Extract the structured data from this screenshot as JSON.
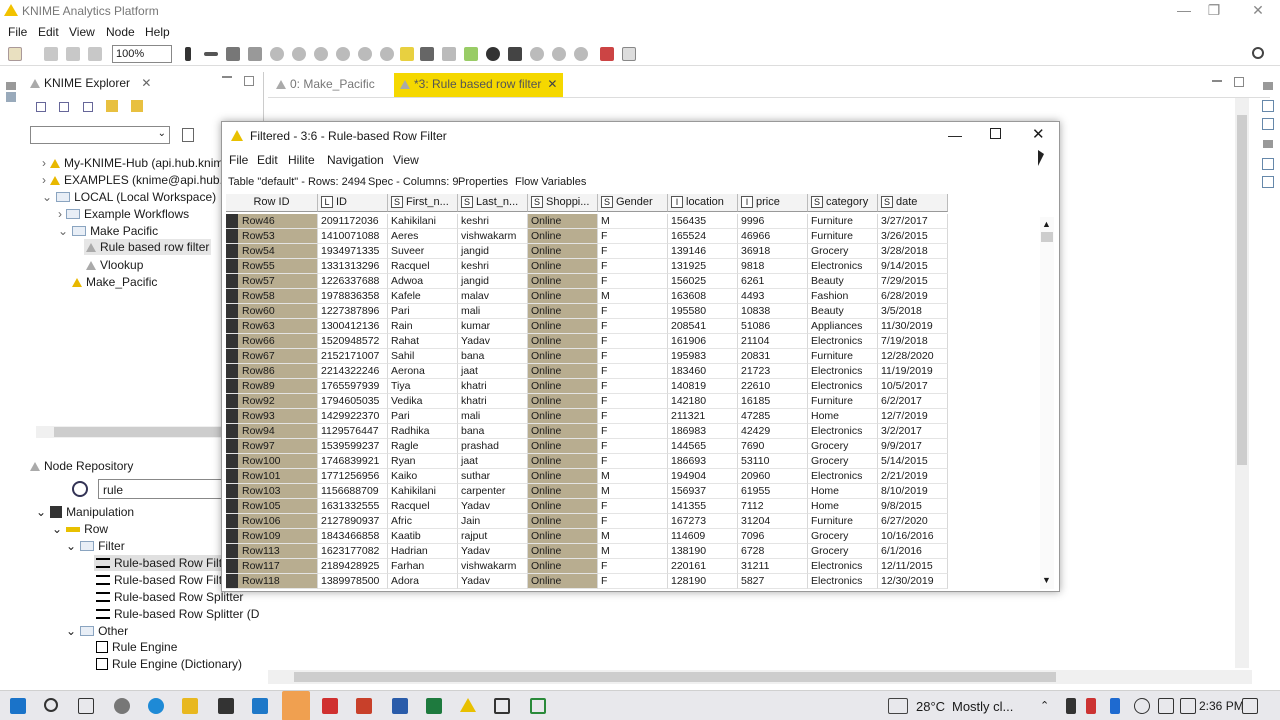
{
  "app": {
    "title": "KNIME Analytics Platform"
  },
  "menu": [
    "File",
    "Edit",
    "View",
    "Node",
    "Help"
  ],
  "toolbar": {
    "zoom": "100%"
  },
  "explorer": {
    "title": "KNIME Explorer",
    "items": [
      "My-KNIME-Hub (api.hub.knim",
      "EXAMPLES (knime@api.hub.k",
      "LOCAL (Local Workspace)",
      "Example Workflows",
      "Make Pacific",
      "Rule based row filter",
      "Vlookup",
      "Make_Pacific"
    ]
  },
  "repo": {
    "title": "Node Repository",
    "search": "rule",
    "items": [
      "Manipulation",
      "Row",
      "Filter",
      "Rule-based Row Filter",
      "Rule-based Row Filter",
      "Rule-based Row Splitter",
      "Rule-based Row Splitter (D",
      "Other",
      "Rule Engine",
      "Rule Engine (Dictionary)"
    ]
  },
  "editor": {
    "tabs": [
      "0: Make_Pacific",
      "*3: Rule based row filter"
    ]
  },
  "window": {
    "title": "Filtered - 3:6 - Rule-based Row Filter",
    "menu": [
      "File",
      "Edit",
      "Hilite",
      "Navigation",
      "View"
    ],
    "info": {
      "table": "Table \"default\" - Rows: 2494",
      "spec": "Spec - Columns: 9",
      "props": "Properties",
      "flow": "Flow Variables"
    },
    "columns": [
      {
        "type": "",
        "name": "Row ID"
      },
      {
        "type": "L",
        "name": "ID"
      },
      {
        "type": "S",
        "name": "First_n..."
      },
      {
        "type": "S",
        "name": "Last_n..."
      },
      {
        "type": "S",
        "name": "Shoppi..."
      },
      {
        "type": "S",
        "name": "Gender"
      },
      {
        "type": "I",
        "name": "location"
      },
      {
        "type": "I",
        "name": "price"
      },
      {
        "type": "S",
        "name": "category"
      },
      {
        "type": "S",
        "name": "date"
      }
    ],
    "rows": [
      [
        "Row46",
        "2091172036",
        "Kahikilani",
        "keshri",
        "Online",
        "M",
        "156435",
        "9996",
        "Furniture",
        "3/27/2017"
      ],
      [
        "Row53",
        "1410071088",
        "Aeres",
        "vishwakarm",
        "Online",
        "F",
        "165524",
        "46966",
        "Furniture",
        "3/26/2015"
      ],
      [
        "Row54",
        "1934971335",
        "Suveer",
        "jangid",
        "Online",
        "F",
        "139146",
        "36918",
        "Grocery",
        "3/28/2018"
      ],
      [
        "Row55",
        "1331313296",
        "Racquel",
        "keshri",
        "Online",
        "F",
        "131925",
        "9818",
        "Electronics",
        "9/14/2015"
      ],
      [
        "Row57",
        "1226337688",
        "Adwoa",
        "jangid",
        "Online",
        "F",
        "156025",
        "6261",
        "Beauty",
        "7/29/2015"
      ],
      [
        "Row58",
        "1978836358",
        "Kafele",
        "malav",
        "Online",
        "M",
        "163608",
        "4493",
        "Fashion",
        "6/28/2019"
      ],
      [
        "Row60",
        "1227387896",
        "Pari",
        "mali",
        "Online",
        "F",
        "195580",
        "10838",
        "Beauty",
        "3/5/2018"
      ],
      [
        "Row63",
        "1300412136",
        "Rain",
        "kumar",
        "Online",
        "F",
        "208541",
        "51086",
        "Appliances",
        "11/30/2019"
      ],
      [
        "Row66",
        "1520948572",
        "Rahat",
        "Yadav",
        "Online",
        "F",
        "161906",
        "21104",
        "Electronics",
        "7/19/2018"
      ],
      [
        "Row67",
        "2152171007",
        "Sahil",
        "bana",
        "Online",
        "F",
        "195983",
        "20831",
        "Furniture",
        "12/28/2020"
      ],
      [
        "Row86",
        "2214322246",
        "Aerona",
        "jaat",
        "Online",
        "F",
        "183460",
        "21723",
        "Electronics",
        "11/19/2019"
      ],
      [
        "Row89",
        "1765597939",
        "Tiya",
        "khatri",
        "Online",
        "F",
        "140819",
        "22610",
        "Electronics",
        "10/5/2017"
      ],
      [
        "Row92",
        "1794605035",
        "Vedika",
        "khatri",
        "Online",
        "F",
        "142180",
        "16185",
        "Furniture",
        "6/2/2017"
      ],
      [
        "Row93",
        "1429922370",
        "Pari",
        "mali",
        "Online",
        "F",
        "211321",
        "47285",
        "Home",
        "12/7/2019"
      ],
      [
        "Row94",
        "1129576447",
        "Radhika",
        "bana",
        "Online",
        "F",
        "186983",
        "42429",
        "Electronics",
        "3/2/2017"
      ],
      [
        "Row97",
        "1539599237",
        "Ragle",
        "prashad",
        "Online",
        "F",
        "144565",
        "7690",
        "Grocery",
        "9/9/2017"
      ],
      [
        "Row100",
        "1746839921",
        "Ryan",
        "jaat",
        "Online",
        "F",
        "186693",
        "53110",
        "Grocery",
        "5/14/2015"
      ],
      [
        "Row101",
        "1771256956",
        "Kaiko",
        "suthar",
        "Online",
        "M",
        "194904",
        "20960",
        "Electronics",
        "2/21/2019"
      ],
      [
        "Row103",
        "1156688709",
        "Kahikilani",
        "carpenter",
        "Online",
        "M",
        "156937",
        "61955",
        "Home",
        "8/10/2019"
      ],
      [
        "Row105",
        "1631332555",
        "Racquel",
        "Yadav",
        "Online",
        "F",
        "141355",
        "7112",
        "Home",
        "9/8/2015"
      ],
      [
        "Row106",
        "2127890937",
        "Afric",
        "Jain",
        "Online",
        "F",
        "167273",
        "31204",
        "Furniture",
        "6/27/2020"
      ],
      [
        "Row109",
        "1843466858",
        "Kaatib",
        "rajput",
        "Online",
        "M",
        "114609",
        "7096",
        "Grocery",
        "10/16/2016"
      ],
      [
        "Row113",
        "1623177082",
        "Hadrian",
        "Yadav",
        "Online",
        "M",
        "138190",
        "6728",
        "Grocery",
        "6/1/2016"
      ],
      [
        "Row117",
        "2189428925",
        "Farhan",
        "vishwakarm",
        "Online",
        "F",
        "220161",
        "31211",
        "Electronics",
        "12/11/2015"
      ],
      [
        "Row118",
        "1389978500",
        "Adora",
        "Yadav",
        "Online",
        "F",
        "128190",
        "5827",
        "Electronics",
        "12/30/2019"
      ]
    ]
  },
  "taskbar": {
    "temp": "28°C",
    "weather": "Mostly cl...",
    "time": "2:36 PM"
  }
}
